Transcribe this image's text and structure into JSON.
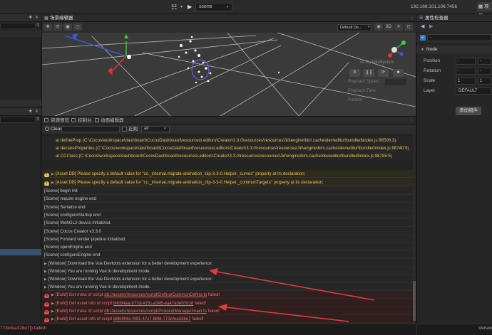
{
  "topbar": {
    "scene_select": "scene",
    "ip": "192.168.101.106:7456",
    "project_label": "项目"
  },
  "scene_panel": {
    "tab_label": "场景编辑器",
    "camera_select": "Default De...",
    "particle": {
      "title": "cc.ParticleSystem",
      "playback_speed_label": "Playback Speed",
      "playback_time_label": "Playback Time",
      "particle_label": "Particle"
    }
  },
  "bottom_tabs": [
    {
      "label": "资源预览"
    },
    {
      "label": "控制台"
    },
    {
      "label": "动画编辑器"
    }
  ],
  "console_toolbar": {
    "clear_label": "Clear",
    "regex_label": "正则",
    "level_select": "all"
  },
  "console": {
    "stack": [
      "at defineProp (C:\\Cocos\\workspace\\dashboard\\CocosDashboard\\resources\\.editors\\Creator\\3.3.0\\resources\\resources\\3d\\engine\\bin\\.cache\\dev\\editor\\bundled\\index.js:98506:3)",
      "at declareProperties (C:\\Cocos\\workspace\\dashboard\\CocosDashboard\\resources\\.editors\\Creator\\3.3.0\\resources\\resources\\3d\\engine\\bin\\.cache\\dev\\editor\\bundled\\index.js:98740:9)",
      "at CCClass (C:\\Cocos\\workspace\\dashboard\\CocosDashboard\\resources\\.editors\\Creator\\3.3.0\\resources\\resources\\3d\\engine\\bin\\.cache\\dev\\editor\\bundled\\index.js:98785:5)"
    ],
    "warnings": [
      "[Asset DB] Please specify a default value for \"cc._internal.migrate-animation_clip-3-3-0.Helper._curves\" property at its declaration;",
      "[Asset DB] Please specify a default value for \"cc._internal.migrate-animation_clip-3-3-0.Helper._commonTargets\" property at its declaration;"
    ],
    "info": [
      "[Scene] begin init",
      "[Scene] require engine end",
      "[Scene] Serialize end",
      "[Scene] configureStartup end",
      "[Scene] WebGL2 device initialized.",
      "[Scene] Cocos Creator v3.3.0",
      "[Scene] Forward render pipeline initialized.",
      "[Scene] openEngine end",
      "[Scene] configureEngine end",
      "[Window] Download the Vue Devtools extension for a better development experience:",
      "[Window] You are running Vue in development mode.",
      "[Window] Download the Vue Devtools extension for a better development experience:",
      "[Window] You are running Vue in development mode."
    ],
    "errors": [
      {
        "prefix": "[Build] Get meta of script ",
        "link": "db://assets/resources/script/Define/CommonDefine.ts",
        "suffix": " failed!"
      },
      {
        "prefix": "[Build] Get asset info of script ",
        "link": "fefc84aa-977d-415c-a345-ea47a3e07b1d",
        "suffix": " failed!"
      },
      {
        "prefix": "[Build] Get meta of script ",
        "link": "db://assets/resources/script/ProtocolManager/main.ts",
        "suffix": " failed!"
      },
      {
        "prefix": "[Build] Get asset info of script ",
        "link": "68fc906c-f491-47c7-8bfd-773efea328e7",
        "suffix": " failed!"
      }
    ]
  },
  "inspector": {
    "tab_label": "属性检查器",
    "node_name": "-",
    "section_label": "Node",
    "properties": [
      {
        "label": "Position",
        "x": "-",
        "y": "-"
      },
      {
        "label": "Rotation",
        "x": "-",
        "y": "-"
      },
      {
        "label": "Scale",
        "x": "1",
        "y": "1"
      }
    ],
    "layer_label": "Layer",
    "layer_value": "DEFAULT",
    "add_component_label": "添加组件"
  },
  "statusbar": {
    "error_text": "773efea328e7}) failed!",
    "version": "Version"
  },
  "colors": {
    "background": "#1e1e1e",
    "panel": "#262626",
    "warning": "#e7c35a",
    "error": "#ef6b6b",
    "accent": "#3c78c8",
    "annotation_arrow": "#e53a3a"
  }
}
